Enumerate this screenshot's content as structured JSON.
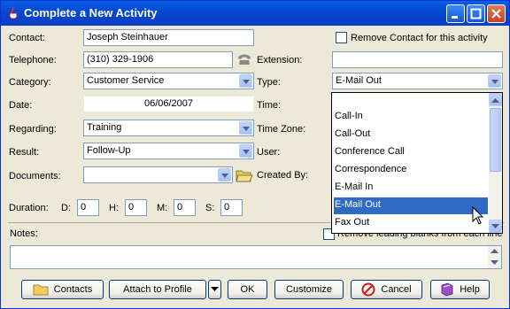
{
  "window": {
    "title": "Complete a New Activity"
  },
  "form": {
    "contact": {
      "label": "Contact:",
      "value": "Joseph Steinhauer"
    },
    "remove_contact": {
      "label": "Remove Contact for this activity"
    },
    "telephone": {
      "label": "Telephone:",
      "value": "(310) 329-1906"
    },
    "extension": {
      "label": "Extension:",
      "value": ""
    },
    "category": {
      "label": "Category:",
      "value": "Customer Service"
    },
    "type": {
      "label": "Type:",
      "value": "E-Mail Out"
    },
    "date": {
      "label": "Date:",
      "value": "06/06/2007"
    },
    "time": {
      "label": "Time:"
    },
    "regarding": {
      "label": "Regarding:",
      "value": "Training"
    },
    "timezone": {
      "label": "Time Zone:"
    },
    "result": {
      "label": "Result:",
      "value": "Follow-Up"
    },
    "user": {
      "label": "User:"
    },
    "documents": {
      "label": "Documents:",
      "value": ""
    },
    "created_by": {
      "label": "Created By:"
    },
    "duration": {
      "label": "Duration:",
      "d_label": "D:",
      "d_value": "0",
      "h_label": "H:",
      "h_value": "0",
      "m_label": "M:",
      "m_value": "0",
      "s_label": "S:",
      "s_value": "0"
    },
    "notes": {
      "label": "Notes:",
      "value": ""
    },
    "remove_blanks": {
      "label": "Remove leading blanks from each line"
    }
  },
  "type_dropdown": {
    "items": [
      "Call-In",
      "Call-Out",
      "Conference Call",
      "Correspondence",
      "E-Mail In",
      "E-Mail Out",
      "Fax Out"
    ],
    "selected": "E-Mail Out"
  },
  "buttons": {
    "contacts": "Contacts",
    "attach": "Attach to Profile",
    "ok": "OK",
    "customize": "Customize",
    "cancel": "Cancel",
    "help": "Help"
  },
  "colors": {
    "titlebar": "#0a5fe6",
    "selection": "#316ac5",
    "background": "#ece9d8"
  }
}
